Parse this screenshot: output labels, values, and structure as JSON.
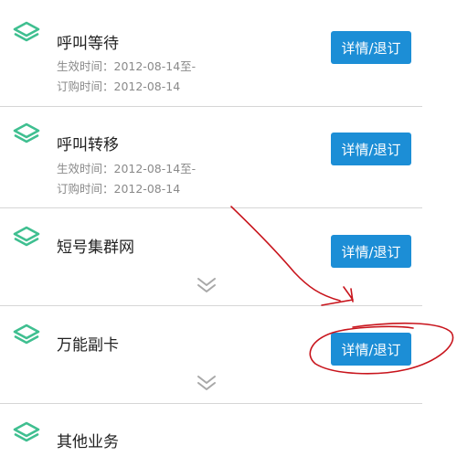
{
  "colors": {
    "accent": "#1c8ed6",
    "icon": "#3fbf90",
    "annotation": "#c8141c",
    "meta_text": "#8a8a8a"
  },
  "icons": {
    "service": "layers-icon",
    "expand": "chevron-double-down-icon"
  },
  "services": [
    {
      "name": "呼叫等待",
      "effective_time": "生效时间：2012-08-14至-",
      "order_time": "订购时间：2012-08-14",
      "button_label": "详情/退订"
    },
    {
      "name": "呼叫转移",
      "effective_time": "生效时间：2012-08-14至-",
      "order_time": "订购时间：2012-08-14",
      "button_label": "详情/退订"
    },
    {
      "name": "短号集群网",
      "button_label": "详情/退订"
    },
    {
      "name": "万能副卡",
      "button_label": "详情/退订"
    },
    {
      "name": "其他业务"
    }
  ]
}
